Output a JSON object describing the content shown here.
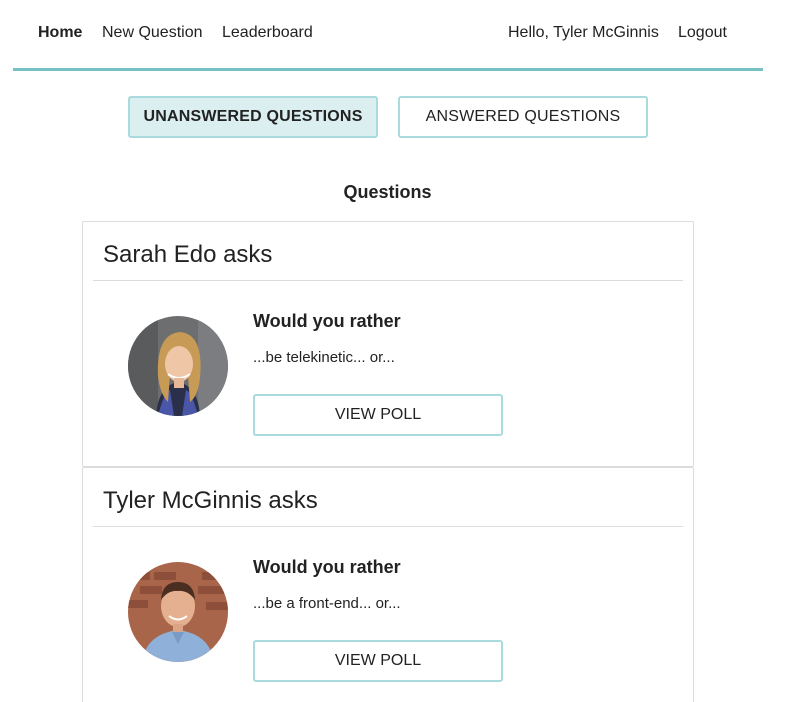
{
  "nav": {
    "home": "Home",
    "new_question": "New Question",
    "leaderboard": "Leaderboard",
    "greeting": "Hello, Tyler McGinnis",
    "logout": "Logout"
  },
  "toggles": {
    "unanswered": "UNANSWERED QUESTIONS",
    "answered": "ANSWERED QUESTIONS",
    "active": "unanswered"
  },
  "section_title": "Questions",
  "questions": [
    {
      "author_heading": "Sarah Edo asks",
      "title": "Would you rather",
      "preview": "...be telekinetic... or...",
      "button": "VIEW POLL"
    },
    {
      "author_heading": "Tyler McGinnis asks",
      "title": "Would you rather",
      "preview": "...be a front-end... or...",
      "button": "VIEW POLL"
    }
  ],
  "colors": {
    "accent": "#76c1c1",
    "button_border": "#a9dadd",
    "active_toggle_bg": "#dbeff0"
  }
}
